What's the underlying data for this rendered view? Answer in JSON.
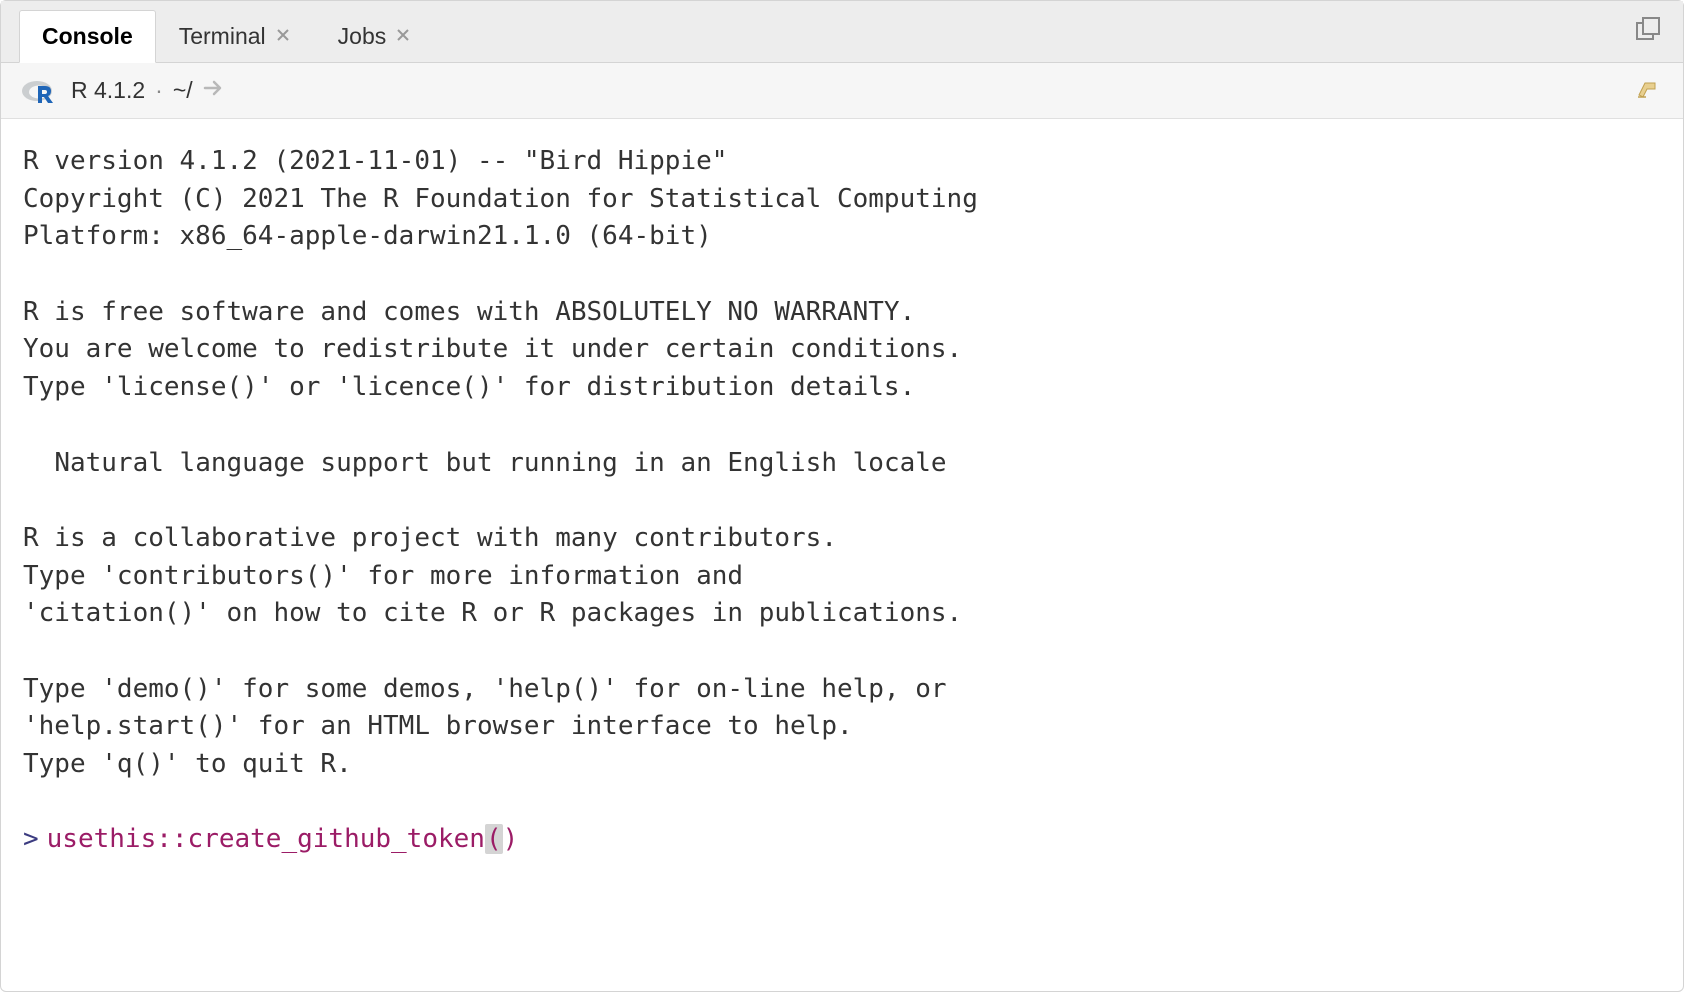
{
  "tabs": [
    {
      "label": "Console",
      "closable": false,
      "active": true
    },
    {
      "label": "Terminal",
      "closable": true,
      "active": false
    },
    {
      "label": "Jobs",
      "closable": true,
      "active": false
    }
  ],
  "infobar": {
    "version": "R 4.1.2",
    "separator": "·",
    "path": "~/"
  },
  "console": {
    "lines": [
      "R version 4.1.2 (2021-11-01) -- \"Bird Hippie\"",
      "Copyright (C) 2021 The R Foundation for Statistical Computing",
      "Platform: x86_64-apple-darwin21.1.0 (64-bit)",
      "",
      "R is free software and comes with ABSOLUTELY NO WARRANTY.",
      "You are welcome to redistribute it under certain conditions.",
      "Type 'license()' or 'licence()' for distribution details.",
      "",
      "  Natural language support but running in an English locale",
      "",
      "R is a collaborative project with many contributors.",
      "Type 'contributors()' for more information and",
      "'citation()' on how to cite R or R packages in publications.",
      "",
      "Type 'demo()' for some demos, 'help()' for on-line help, or",
      "'help.start()' for an HTML browser interface to help.",
      "Type 'q()' to quit R.",
      ""
    ],
    "prompt": ">",
    "command_pre": "usethis::create_github_token",
    "command_open": "(",
    "command_close": ")"
  }
}
